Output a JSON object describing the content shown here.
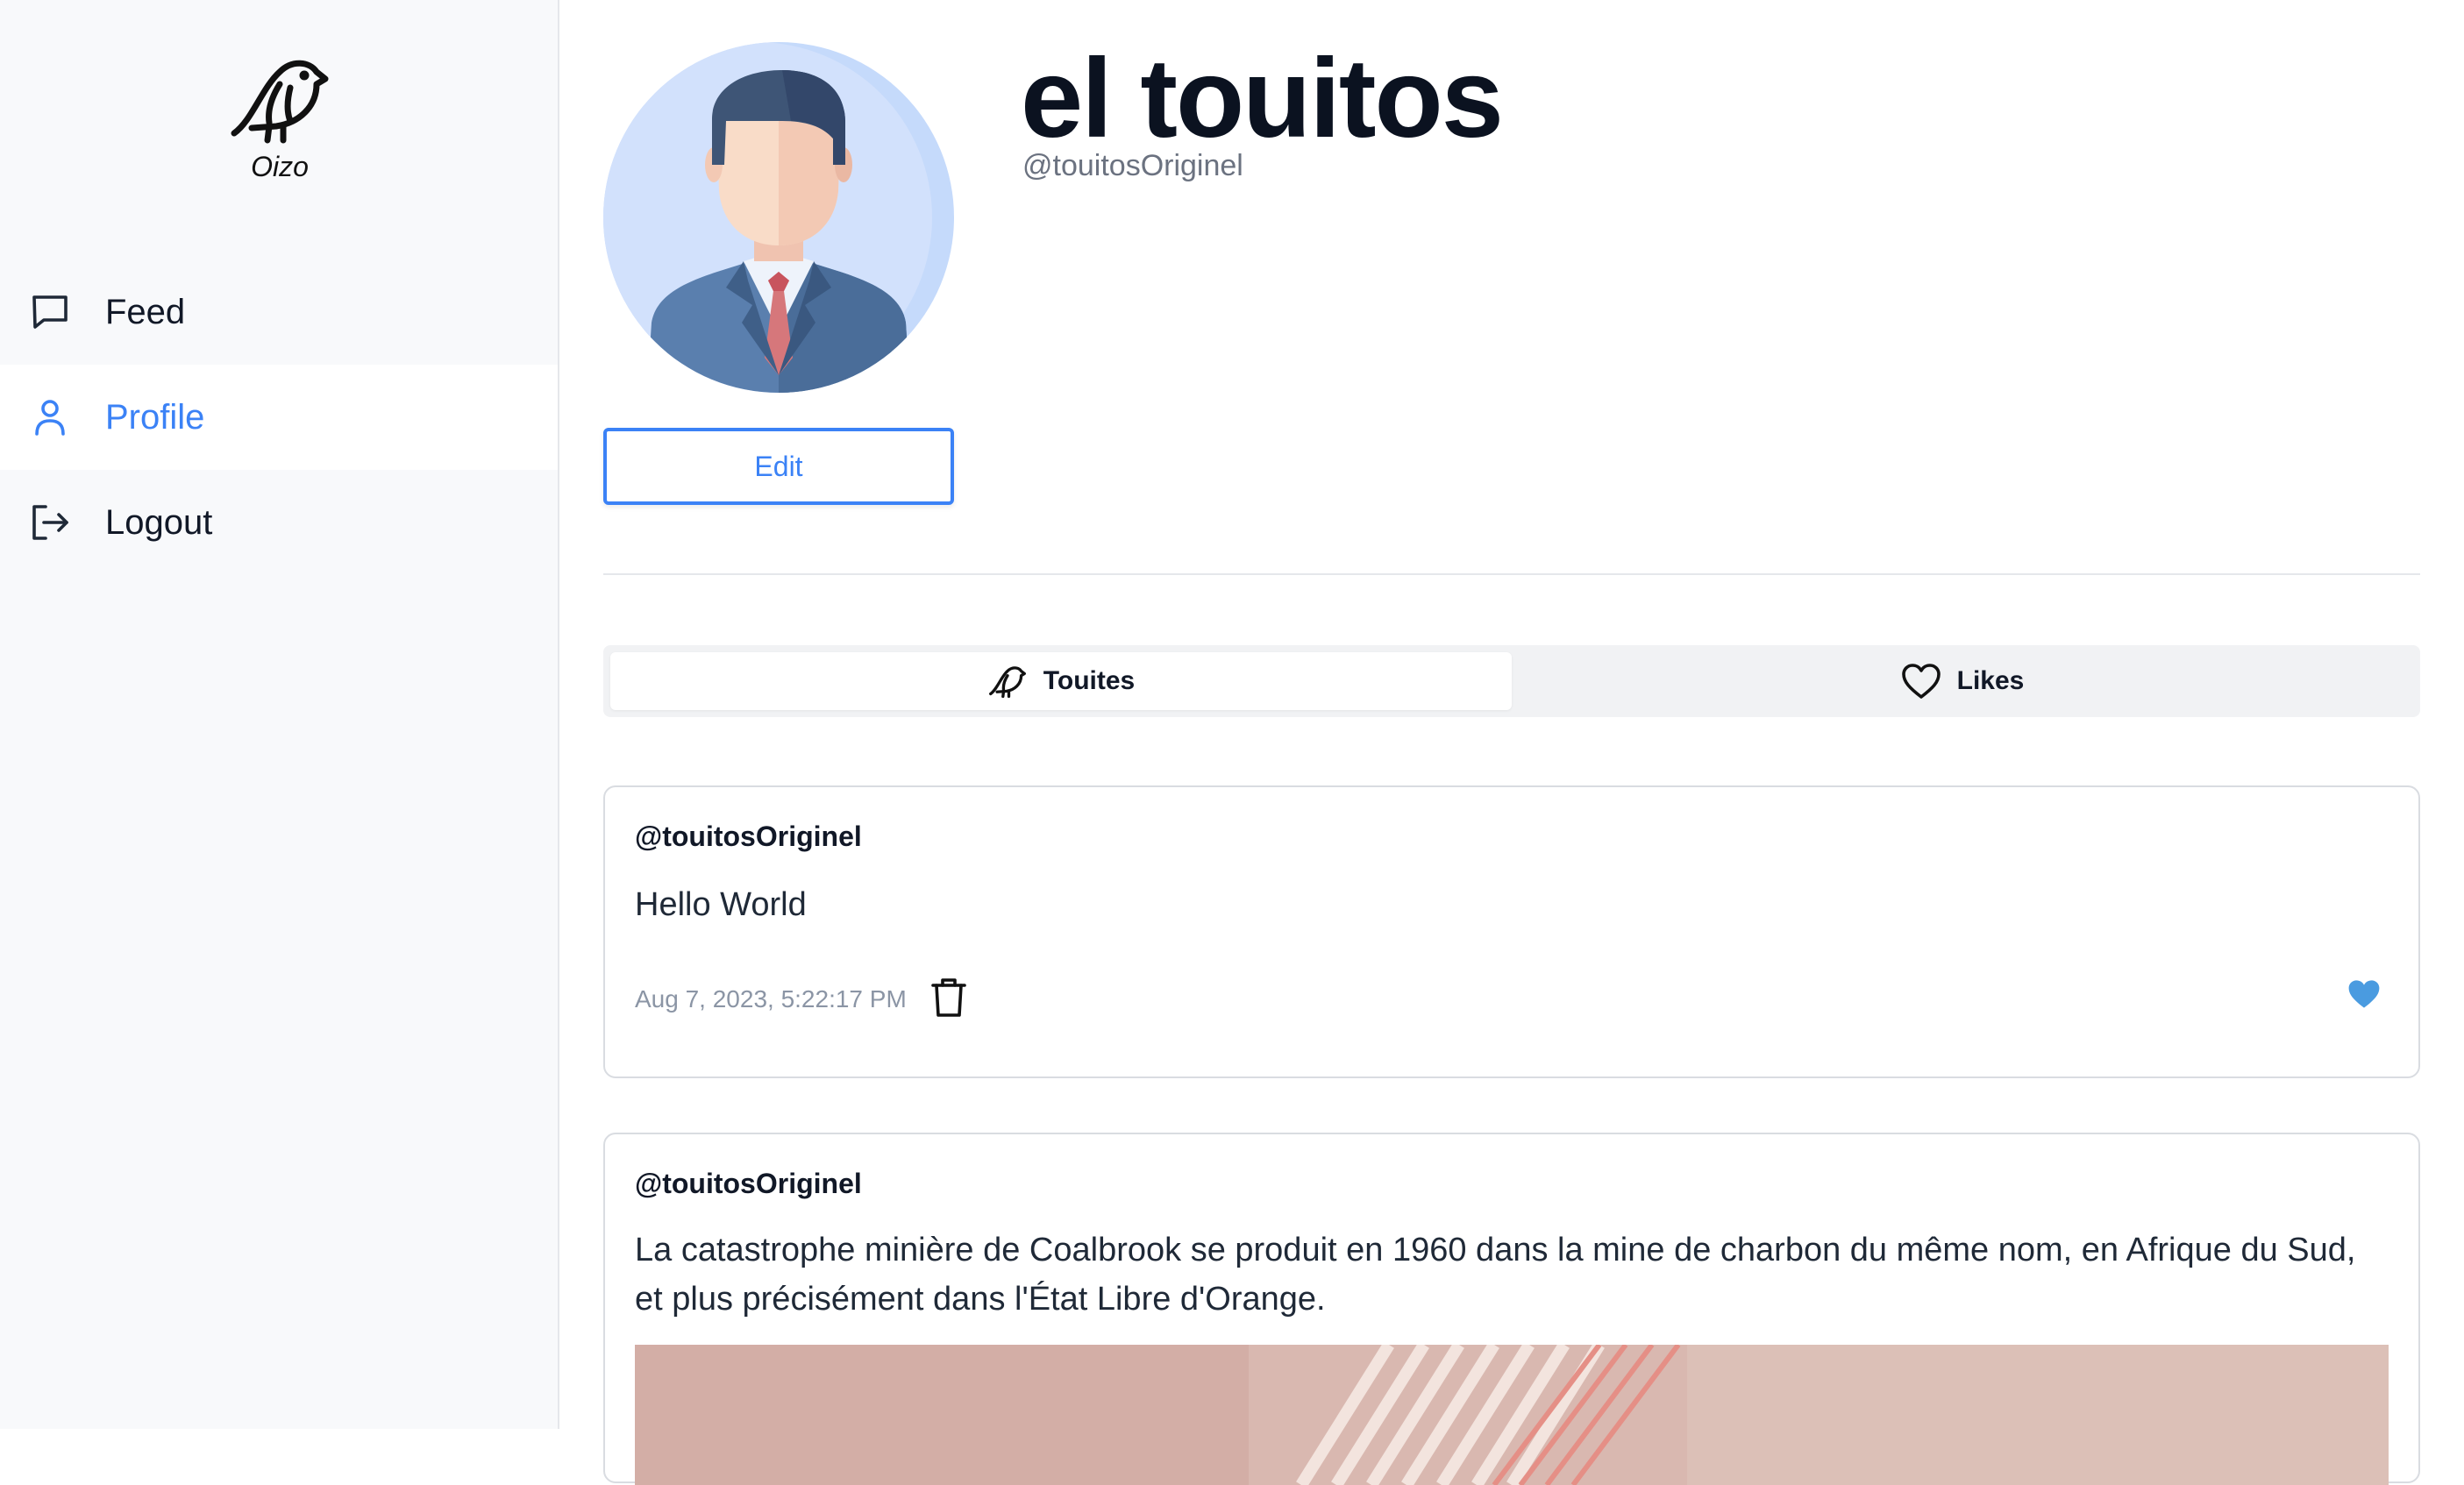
{
  "app": {
    "logo_text": "Oizo"
  },
  "sidebar": {
    "items": [
      {
        "label": "Feed",
        "icon": "chat-bubble-icon",
        "active": false
      },
      {
        "label": "Profile",
        "icon": "user-icon",
        "active": true
      },
      {
        "label": "Logout",
        "icon": "logout-icon",
        "active": false
      }
    ]
  },
  "profile": {
    "display_name": "el touitos",
    "handle": "@touitosOriginel",
    "edit_label": "Edit"
  },
  "tabs": [
    {
      "label": "Touites",
      "icon": "bird-icon",
      "active": true
    },
    {
      "label": "Likes",
      "icon": "heart-outline-icon",
      "active": false
    }
  ],
  "posts": [
    {
      "author": "@touitosOriginel",
      "text": "Hello World",
      "date": "Aug 7, 2023, 5:22:17 PM",
      "liked": true
    },
    {
      "author": "@touitosOriginel",
      "text": "La catastrophe minière de Coalbrook se produit en 1960 dans la mine de charbon du même nom, en Afrique du Sud, et plus précisément dans l'État Libre d'Orange."
    }
  ],
  "colors": {
    "accent": "#3b82f6",
    "like": "#4a9be0",
    "sidebar_bg": "#f8f9fb"
  }
}
